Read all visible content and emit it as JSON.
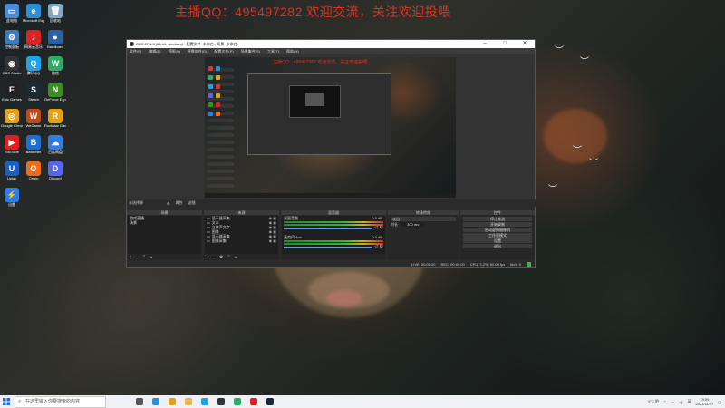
{
  "banner": "主播QQ：495497282 欢迎交流，关注欢迎投喂",
  "desktop_icons": [
    {
      "label": "此电脑",
      "color": "#4a8ad8",
      "glyph": "▭"
    },
    {
      "label": "Microsoft Edge",
      "color": "#2b8fd6",
      "glyph": "e"
    },
    {
      "label": "回收站",
      "color": "#7fa8c8",
      "glyph": "🗑"
    },
    {
      "label": "控制面板",
      "color": "#3b7bc0",
      "glyph": "⚙"
    },
    {
      "label": "网易云音乐",
      "color": "#d22",
      "glyph": "♪"
    },
    {
      "label": "Bandicam",
      "color": "#2b5fa8",
      "glyph": "●"
    },
    {
      "label": "OBS Studio",
      "color": "#333",
      "glyph": "◉"
    },
    {
      "label": "腾讯QQ",
      "color": "#1fa3e8",
      "glyph": "Q"
    },
    {
      "label": "微信",
      "color": "#2aae67",
      "glyph": "W"
    },
    {
      "label": "Epic Games",
      "color": "#222",
      "glyph": "E"
    },
    {
      "label": "Steam",
      "color": "#1b2838",
      "glyph": "S"
    },
    {
      "label": "GeForce Experience",
      "color": "#3a8f23",
      "glyph": "N"
    },
    {
      "label": "Google Chrome",
      "color": "#e2a21b",
      "glyph": "◎"
    },
    {
      "label": "WeGame",
      "color": "#c04a1c",
      "glyph": "W"
    },
    {
      "label": "Rockstar Games",
      "color": "#e8a100",
      "glyph": "R"
    },
    {
      "label": "YouTube",
      "color": "#e02020",
      "glyph": "▶"
    },
    {
      "label": "BattleNet",
      "color": "#1d6fd0",
      "glyph": "B"
    },
    {
      "label": "百度网盘",
      "color": "#2f7de0",
      "glyph": "☁"
    },
    {
      "label": "Uplay",
      "color": "#1e5dc0",
      "glyph": "U"
    },
    {
      "label": "Origin",
      "color": "#f26b1d",
      "glyph": "O"
    },
    {
      "label": "Discord",
      "color": "#5865f2",
      "glyph": "D"
    },
    {
      "label": "迅雷",
      "color": "#2f7de0",
      "glyph": "⚡"
    }
  ],
  "obs": {
    "title": "OBS 27.1.3 (64-bit, windows) - 配置文件: 未命名 - 场景: 未命名",
    "menu": [
      "文件(F)",
      "编辑(E)",
      "视图(V)",
      "停靠部件(D)",
      "配置文件(P)",
      "场景集合(S)",
      "工具(T)",
      "帮助(H)"
    ],
    "source_bar": [
      "未选择源",
      "属性",
      "滤镜"
    ],
    "docks": {
      "scenes": {
        "title": "场景",
        "items": [
          "游戏直播",
          "场景"
        ]
      },
      "sources": {
        "title": "来源",
        "items": [
          "显示器采集",
          "文本",
          "立体声文字",
          "图像",
          "显示器采集",
          "图像采集"
        ]
      },
      "mixer": {
        "title": "混音器",
        "tracks": [
          {
            "name": "桌面音频",
            "level": "0.0 dB"
          },
          {
            "name": "麦克风/Aux",
            "level": "0.0 dB"
          }
        ]
      },
      "transitions": {
        "title": "转场特效",
        "type": "淡出",
        "duration_label": "时长",
        "duration": "300 ms"
      },
      "controls": {
        "title": "控件",
        "buttons": [
          "停止推流",
          "开始录制",
          "启动虚拟摄像机",
          "工作室模式",
          "设置",
          "退出"
        ]
      }
    },
    "status": {
      "live": "LIVE: 00:00:00",
      "rec": "REC: 00:00:00",
      "cpu": "CPU: 3.2%, 60.00 fps",
      "kbps": "kb/s: 0"
    }
  },
  "taskbar": {
    "search_placeholder": "在这里输入你要搜索的内容",
    "apps": [
      {
        "name": "task-view",
        "color": "#555"
      },
      {
        "name": "edge",
        "color": "#2b8fd6"
      },
      {
        "name": "chrome",
        "color": "#e2a21b"
      },
      {
        "name": "explorer",
        "color": "#e8b74a"
      },
      {
        "name": "qq",
        "color": "#1fa3e8"
      },
      {
        "name": "obs",
        "color": "#333"
      },
      {
        "name": "wechat",
        "color": "#2aae67"
      },
      {
        "name": "music",
        "color": "#d22"
      },
      {
        "name": "steam",
        "color": "#1b2838"
      }
    ],
    "weather": "9°C 阴",
    "ime": "英",
    "time": "19:59",
    "date": "2021/11/27"
  }
}
